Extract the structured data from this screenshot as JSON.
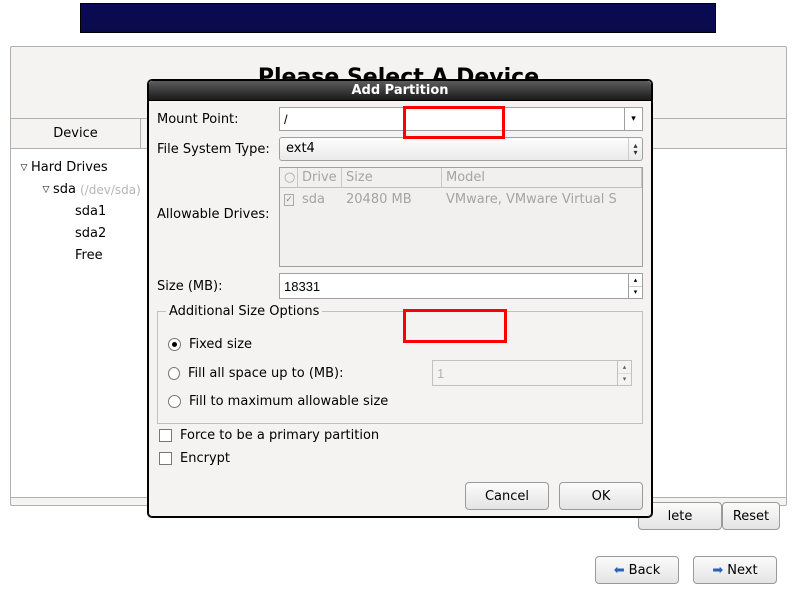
{
  "parent": {
    "page_title": "Please Select A Device",
    "columns": {
      "device": "Device"
    },
    "tree": {
      "root": "Hard Drives",
      "disk": "sda",
      "disk_path": "(/dev/sda)",
      "partitions": [
        "sda1",
        "sda2",
        "Free"
      ]
    },
    "buttons": {
      "delete_partial": "lete",
      "reset": "Reset",
      "back": "Back",
      "next": "Next"
    }
  },
  "dialog": {
    "title": "Add Partition",
    "labels": {
      "mount_point": "Mount Point:",
      "fs_type": "File System Type:",
      "allowable_drives": "Allowable Drives:",
      "size": "Size (MB):",
      "additional_opts": "Additional Size Options",
      "fixed_size": "Fixed size",
      "fill_upto": "Fill all space up to (MB):",
      "fill_max": "Fill to maximum allowable size",
      "force_primary": "Force to be a primary partition",
      "encrypt": "Encrypt"
    },
    "values": {
      "mount_point": "/",
      "fs_type": "ext4",
      "size_mb": "18331",
      "fill_upto_value": "1"
    },
    "drive_table": {
      "headers": {
        "drive": "Drive",
        "size": "Size",
        "model": "Model"
      },
      "row": {
        "drive": "sda",
        "size": "20480 MB",
        "model": "VMware, VMware Virtual S"
      }
    },
    "buttons": {
      "cancel": "Cancel",
      "ok": "OK"
    }
  }
}
